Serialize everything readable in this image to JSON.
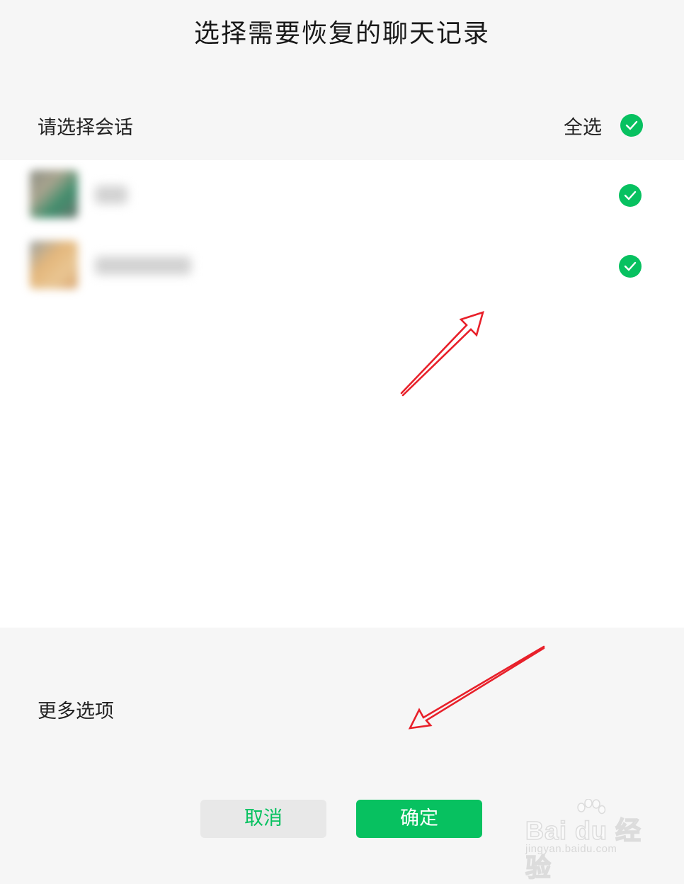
{
  "header": {
    "title": "选择需要恢复的聊天记录"
  },
  "selection": {
    "label": "请选择会话",
    "select_all_label": "全选",
    "select_all_checked": true
  },
  "conversations": [
    {
      "checked": true
    },
    {
      "checked": true
    }
  ],
  "more_options_label": "更多选项",
  "buttons": {
    "cancel": "取消",
    "confirm": "确定"
  },
  "watermark": {
    "brand": "Bai du 经验",
    "url": "jingyan.baidu.com"
  },
  "colors": {
    "accent": "#07c160",
    "annotation_arrow": "#e8202a",
    "panel_bg": "#f6f6f6",
    "list_bg": "#ffffff"
  }
}
